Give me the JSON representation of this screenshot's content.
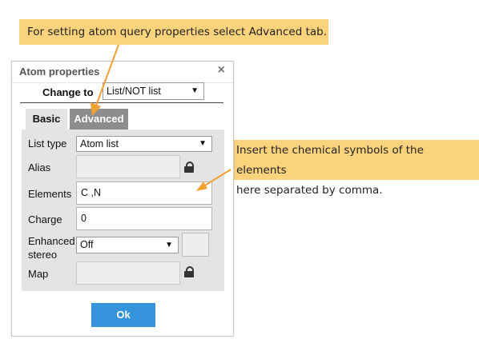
{
  "callouts": {
    "top": "For setting atom query properties select Advanced tab.",
    "right_line1": "Insert the chemical symbols of the elements",
    "right_line2": "here separated by comma."
  },
  "dialog": {
    "title": "Atom properties",
    "close": "×",
    "change_to_label": "Change to",
    "change_to_value": "List/NOT list",
    "tabs": {
      "basic": "Basic",
      "advanced": "Advanced"
    },
    "fields": {
      "list_type_label": "List type",
      "list_type_value": "Atom list",
      "alias_label": "Alias",
      "elements_label": "Elements",
      "elements_value": "C ,N",
      "charge_label": "Charge",
      "charge_value": "0",
      "enhanced_stereo_label_1": "Enhanced",
      "enhanced_stereo_label_2": "stereo",
      "enhanced_stereo_value": "Off",
      "map_label": "Map"
    },
    "ok_label": "Ok"
  },
  "colors": {
    "callout_bg": "#fbd37d",
    "arrow": "#f0a030",
    "ok_button": "#3593dc",
    "active_tab": "#8d8d8d"
  },
  "icons": {
    "lock": "lock-icon",
    "caret": "chevron-down-icon",
    "close": "close-icon"
  }
}
